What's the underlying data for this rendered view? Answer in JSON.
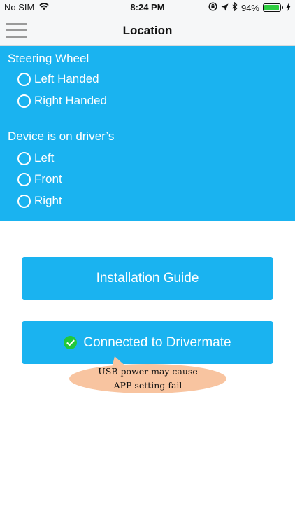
{
  "status_bar": {
    "carrier": "No SIM",
    "time": "8:24 PM",
    "battery_percent": "94%",
    "battery_level": 0.94,
    "icons": [
      "wifi-icon",
      "orientation-lock-icon",
      "location-arrow-icon",
      "bluetooth-icon",
      "battery-icon",
      "charging-bolt-icon"
    ]
  },
  "nav": {
    "title": "Location",
    "menu_icon": "hamburger-menu-icon"
  },
  "settings": {
    "steering_title": "Steering Wheel",
    "steering_options": [
      {
        "label": "Left Handed",
        "selected": false
      },
      {
        "label": "Right Handed",
        "selected": false
      }
    ],
    "device_title": "Device is on driver’s",
    "device_options": [
      {
        "label": "Left",
        "selected": false
      },
      {
        "label": "Front",
        "selected": false
      },
      {
        "label": "Right",
        "selected": false
      }
    ]
  },
  "buttons": {
    "installation_guide": "Installation Guide",
    "connected": "Connected to Drivermate"
  },
  "tooltip": {
    "line1": "USB power may cause",
    "line2": "APP setting fail"
  },
  "colors": {
    "accent": "#1ab3f0",
    "success": "#22c83c",
    "tooltip_bg": "#f8c4a0",
    "battery": "#2ecc40"
  }
}
